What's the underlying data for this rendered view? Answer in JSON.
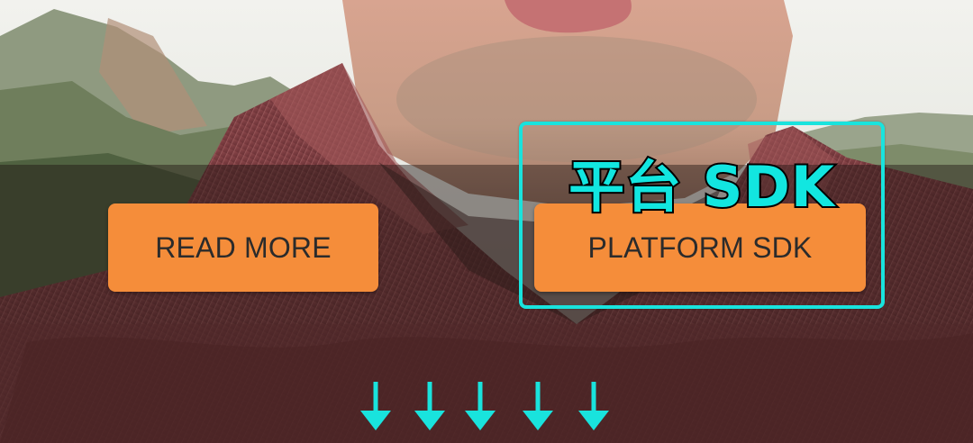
{
  "buttons": {
    "read_more": "READ MORE",
    "platform_sdk": "PLATFORM SDK"
  },
  "annotation": {
    "label": "平台 SDK"
  },
  "colors": {
    "button_bg": "#f58d3a",
    "button_text": "#2b2b2b",
    "annotation": "#19e3dd"
  },
  "icons": [
    "down-arrow-icon"
  ]
}
